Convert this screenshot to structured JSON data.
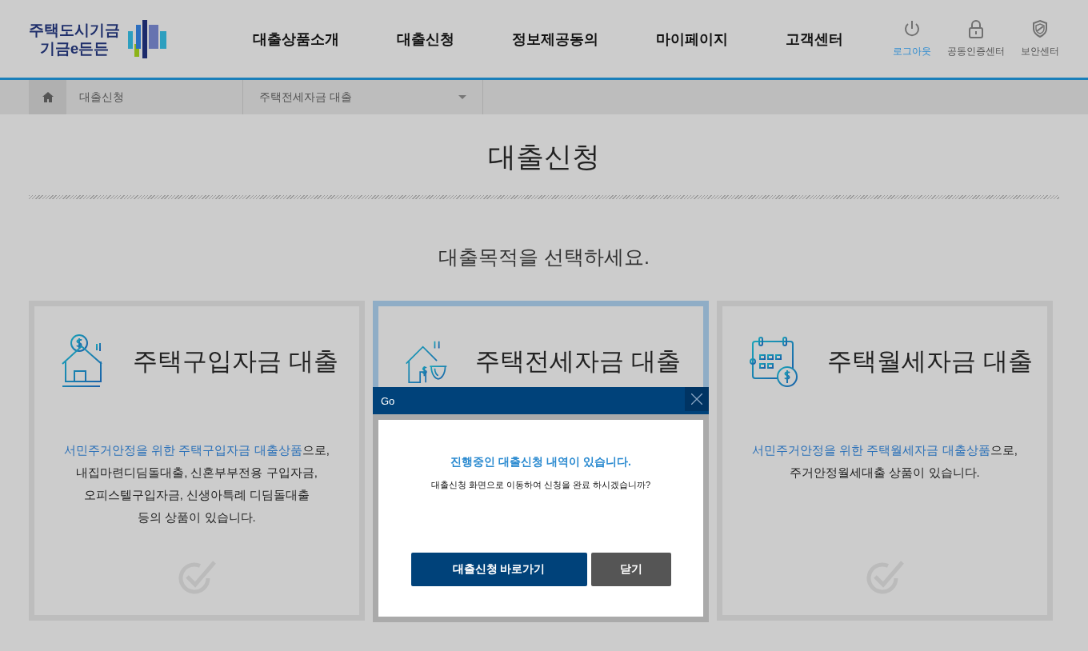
{
  "logo": {
    "line_1": "주택도시기금",
    "line_2": "기금e든든"
  },
  "nav": [
    "대출상품소개",
    "대출신청",
    "정보제공동의",
    "마이페이지",
    "고객센터"
  ],
  "utility": [
    {
      "kind": "power",
      "label": "로그아웃",
      "active": true
    },
    {
      "kind": "lock",
      "label": "공동인증센터",
      "active": false
    },
    {
      "kind": "shield",
      "label": "보안센터",
      "active": false
    }
  ],
  "breadcrumb": {
    "section": "대출신청",
    "current": "주택전세자금 대출"
  },
  "page_title": "대출신청",
  "prompt": "대출목적을 선택하세요.",
  "cards": [
    {
      "kind": "house-coin",
      "title": "주택구입자금 대출",
      "selected": false,
      "highlight": "서민주거안정을 위한 주택구입자금 대출상품",
      "text": "으로,\n내집마련디딤돌대출, 신혼부부전용 구입자금,\n오피스텔구입자금, 신생아특례 디딤돌대출\n등의 상품이 있습니다."
    },
    {
      "kind": "house-bowl",
      "title": "주택전세자금 대출",
      "selected": true
    },
    {
      "kind": "calendar-coin",
      "title": "주택월세자금 대출",
      "selected": false,
      "highlight": "서민주거안정을 위한 주택월세자금 대출상품",
      "text": "으로,\n주거안정월세대출 상품이 있습니다."
    }
  ],
  "dialog": {
    "title": "Go",
    "heading": "진행중인 대출신청 내역이 있습니다.",
    "message": "대출신청 화면으로 이동하여 신청을 완료 하시겠습니까?",
    "buttons": [
      {
        "kind": "primary",
        "label": "대출신청 바로가기"
      },
      {
        "kind": "secondary",
        "label": "닫기"
      }
    ]
  }
}
